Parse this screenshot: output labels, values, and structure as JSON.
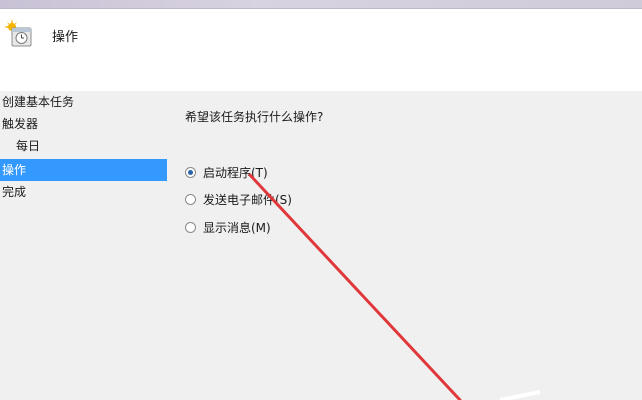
{
  "header": {
    "title": "操作",
    "icon": "task-scheduler-icon"
  },
  "sidebar": {
    "items": [
      {
        "label": "创建基本任务",
        "selected": false
      },
      {
        "label": "触发器",
        "selected": false
      },
      {
        "label": "每日",
        "selected": false
      },
      {
        "label": "操作",
        "selected": true
      },
      {
        "label": "完成",
        "selected": false
      }
    ]
  },
  "main": {
    "question": "希望该任务执行什么操作?",
    "options": [
      {
        "label": "启动程序(T)",
        "checked": true
      },
      {
        "label": "发送电子邮件(S)",
        "checked": false
      },
      {
        "label": "显示消息(M)",
        "checked": false
      }
    ]
  },
  "colors": {
    "selection": "#3399ff",
    "annotation_arrow": "#e0383a"
  }
}
